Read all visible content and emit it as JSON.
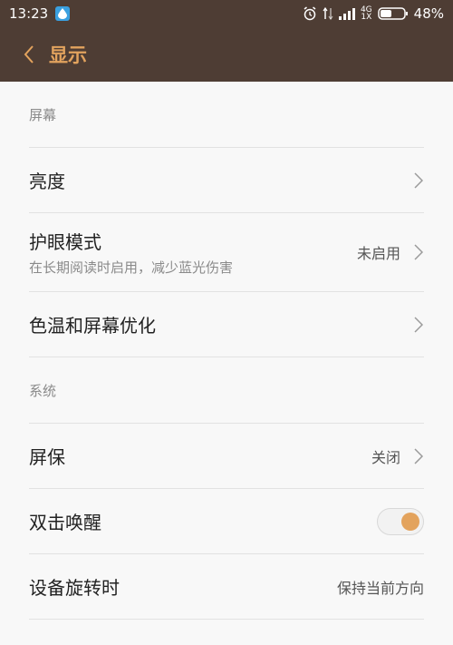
{
  "status_bar": {
    "time": "13:23",
    "network_top": "4G",
    "network_bottom": "1X",
    "battery": "48%",
    "battery_level": 0.48
  },
  "header": {
    "title": "显示"
  },
  "sections": {
    "screen": {
      "header": "屏幕",
      "brightness": {
        "label": "亮度"
      },
      "eye_protection": {
        "label": "护眼模式",
        "sub": "在长期阅读时启用，减少蓝光伤害",
        "value": "未启用"
      },
      "color_temp": {
        "label": "色温和屏幕优化"
      }
    },
    "system": {
      "header": "系统",
      "screensaver": {
        "label": "屏保",
        "value": "关闭"
      },
      "double_tap": {
        "label": "双击唤醒",
        "enabled": true
      },
      "rotation": {
        "label": "设备旋转时",
        "value": "保持当前方向"
      }
    }
  },
  "colors": {
    "header_bg": "#4e3d34",
    "accent": "#e3a35d",
    "background": "#f8f8f8"
  }
}
